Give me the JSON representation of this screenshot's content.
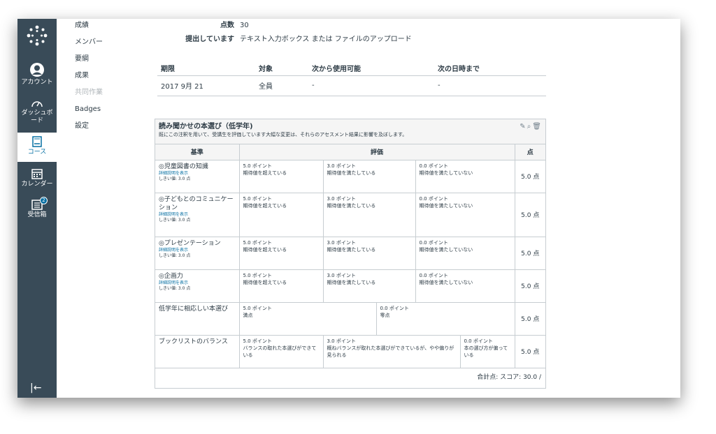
{
  "global_nav": {
    "account": "アカウント",
    "dashboard": "ダッシュボード",
    "courses": "コース",
    "calendar": "カレンダー",
    "inbox": "受信箱",
    "inbox_badge": "2"
  },
  "course_nav": [
    "成績",
    "メンバー",
    "要綱",
    "成果",
    "共同作業",
    "Badges",
    "設定"
  ],
  "details": {
    "points_label": "点数",
    "points_value": "30",
    "submitting_label": "提出しています",
    "submitting_value": "テキスト入力ボックス または ファイルのアップロード"
  },
  "due_table": {
    "headers": [
      "期限",
      "対象",
      "次から使用可能",
      "次の日時まで"
    ],
    "row": [
      "2017 9月 21",
      "全員",
      "-",
      "-"
    ]
  },
  "rubric": {
    "title": "読み聞かせの本選び（低学年)",
    "description": "既にこの注釈を用いて、受講生を評価しています大幅な変更は、それらのアセスメント結果に影響を及ぼします。",
    "col_criteria": "基準",
    "col_ratings": "評価",
    "col_points": "点",
    "long_description_link": "詳細説明を表示",
    "threshold": "しきい値: 3.0 点",
    "rows": [
      {
        "name": "児童図書の知識",
        "outcome": true,
        "ratings": [
          {
            "pts": "5.0 ポイント",
            "desc": "期待値を超えている"
          },
          {
            "pts": "3.0 ポイント",
            "desc": "期待値を満たしている"
          },
          {
            "pts": "0.0 ポイント",
            "desc": "期待値を満たしていない"
          }
        ],
        "points": "5.0 点"
      },
      {
        "name": "子どもとのコミュニケーション",
        "outcome": true,
        "ratings": [
          {
            "pts": "5.0 ポイント",
            "desc": "期待値を超えている"
          },
          {
            "pts": "3.0 ポイント",
            "desc": "期待値を満たしている"
          },
          {
            "pts": "0.0 ポイント",
            "desc": "期待値を満たしていない"
          }
        ],
        "points": "5.0 点"
      },
      {
        "name": "プレゼンテーション",
        "outcome": true,
        "ratings": [
          {
            "pts": "5.0 ポイント",
            "desc": "期待値を超えている"
          },
          {
            "pts": "3.0 ポイント",
            "desc": "期待値を満たしている"
          },
          {
            "pts": "0.0 ポイント",
            "desc": "期待値を満たしていない"
          }
        ],
        "points": "5.0 点"
      },
      {
        "name": "企画力",
        "outcome": true,
        "ratings": [
          {
            "pts": "5.0 ポイント",
            "desc": "期待値を超えている"
          },
          {
            "pts": "3.0 ポイント",
            "desc": "期待値を満たしている"
          },
          {
            "pts": "0.0 ポイント",
            "desc": "期待値を満たしていない"
          }
        ],
        "points": "5.0 点"
      },
      {
        "name": "低学年に相応しい本選び",
        "outcome": false,
        "ratings": [
          {
            "pts": "5.0 ポイント",
            "desc": "満点"
          },
          {
            "pts": "0.0 ポイント",
            "desc": "零点"
          }
        ],
        "points": "5.0 点"
      },
      {
        "name": "ブックリストのバランス",
        "outcome": false,
        "ratings": [
          {
            "pts": "5.0 ポイント",
            "desc": "バランスの取れた本選びができている"
          },
          {
            "pts": "3.0 ポイント",
            "desc": "概ねバランスが取れた本選びができているが、やや偏りが見られる"
          },
          {
            "pts": "0.0 ポイント",
            "desc": "本の選び方が偏っている"
          }
        ],
        "points": "5.0 点"
      }
    ],
    "total": "合計点: スコア: 30.0 /"
  }
}
